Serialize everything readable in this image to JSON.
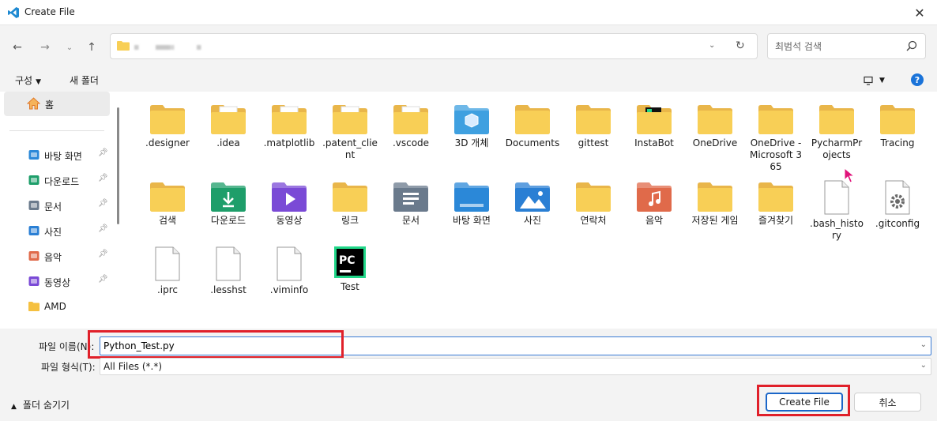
{
  "window": {
    "title": "Create File",
    "app_icon": "vscode-icon",
    "close_icon": "close-icon"
  },
  "nav": {
    "back_icon": "arrow-left-icon",
    "forward_icon": "arrow-right-icon",
    "recent_icon": "chevron-down-icon",
    "up_icon": "arrow-up-icon"
  },
  "address": {
    "folder_icon": "folder-icon",
    "refresh_icon": "refresh-icon"
  },
  "search": {
    "placeholder": "최범석 검색",
    "icon": "search-icon"
  },
  "toolbar": {
    "organize": "구성",
    "new_folder": "새 폴더",
    "view_icon": "view-icon",
    "help": "?"
  },
  "sidebar": {
    "home": "홈",
    "items": [
      {
        "label": "바탕 화면",
        "icon": "desktop-icon",
        "color": "#2b88d8"
      },
      {
        "label": "다운로드",
        "icon": "download-icon",
        "color": "#1e9e6a"
      },
      {
        "label": "문서",
        "icon": "document-icon",
        "color": "#6a7a8c"
      },
      {
        "label": "사진",
        "icon": "picture-icon",
        "color": "#2a7fd4"
      },
      {
        "label": "음악",
        "icon": "music-icon",
        "color": "#e06a4a"
      },
      {
        "label": "동영상",
        "icon": "video-icon",
        "color": "#7a4ad6"
      },
      {
        "label": "AMD",
        "icon": "folder-icon",
        "color": "#f5c040"
      }
    ]
  },
  "files": [
    {
      "label": ".designer",
      "icon": "folder-icon",
      "kind": "folder"
    },
    {
      "label": ".idea",
      "icon": "folder-icon",
      "kind": "folder-doc"
    },
    {
      "label": ".matplotlib",
      "icon": "folder-icon",
      "kind": "folder-doc"
    },
    {
      "label": ".patent_client",
      "icon": "folder-icon",
      "kind": "folder-doc"
    },
    {
      "label": ".vscode",
      "icon": "folder-icon",
      "kind": "folder-doc"
    },
    {
      "label": "3D 개체",
      "icon": "3d-objects-icon",
      "kind": "special",
      "color": "#3fa0e0"
    },
    {
      "label": "Documents",
      "icon": "folder-icon",
      "kind": "folder"
    },
    {
      "label": "gittest",
      "icon": "folder-icon",
      "kind": "folder"
    },
    {
      "label": "InstaBot",
      "icon": "pycharm-folder-icon",
      "kind": "pycharm-folder"
    },
    {
      "label": "OneDrive",
      "icon": "folder-icon",
      "kind": "folder"
    },
    {
      "label": "OneDrive - Microsoft 365",
      "icon": "folder-icon",
      "kind": "folder"
    },
    {
      "label": "PycharmProjects",
      "icon": "folder-icon",
      "kind": "folder"
    },
    {
      "label": "Tracing",
      "icon": "folder-icon",
      "kind": "folder"
    },
    {
      "label": "검색",
      "icon": "folder-icon",
      "kind": "folder"
    },
    {
      "label": "다운로드",
      "icon": "download-folder-icon",
      "kind": "special",
      "color": "#1e9e6a"
    },
    {
      "label": "동영상",
      "icon": "video-folder-icon",
      "kind": "special",
      "color": "#7a4ad6"
    },
    {
      "label": "링크",
      "icon": "folder-icon",
      "kind": "folder"
    },
    {
      "label": "문서",
      "icon": "document-folder-icon",
      "kind": "special",
      "color": "#6a7a8c"
    },
    {
      "label": "바탕 화면",
      "icon": "desktop-folder-icon",
      "kind": "special",
      "color": "#2b88d8"
    },
    {
      "label": "사진",
      "icon": "picture-folder-icon",
      "kind": "special",
      "color": "#2a7fd4"
    },
    {
      "label": "연락처",
      "icon": "folder-icon",
      "kind": "folder"
    },
    {
      "label": "음악",
      "icon": "music-folder-icon",
      "kind": "special",
      "color": "#e06a4a"
    },
    {
      "label": "저장된 게임",
      "icon": "folder-icon",
      "kind": "folder"
    },
    {
      "label": "즐겨찾기",
      "icon": "folder-icon",
      "kind": "folder"
    },
    {
      "label": ".bash_history",
      "icon": "file-icon",
      "kind": "file"
    },
    {
      "label": ".gitconfig",
      "icon": "settings-file-icon",
      "kind": "gear-file"
    },
    {
      "label": ".iprc",
      "icon": "file-icon",
      "kind": "file"
    },
    {
      "label": ".lesshst",
      "icon": "file-icon",
      "kind": "file"
    },
    {
      "label": ".viminfo",
      "icon": "file-icon",
      "kind": "file"
    },
    {
      "label": "Test",
      "icon": "pycharm-icon",
      "kind": "pycharm"
    }
  ],
  "filename": {
    "label": "파일 이름(N):",
    "value": "Python_Test.py"
  },
  "filetype": {
    "label": "파일 형식(T):",
    "value": "All Files (*.*)"
  },
  "footer": {
    "hide_folders": "폴더 숨기기",
    "create": "Create File",
    "cancel": "취소"
  },
  "colors": {
    "accent": "#1a66c8",
    "highlight": "#e0202a",
    "folder": "#f8cf56"
  }
}
